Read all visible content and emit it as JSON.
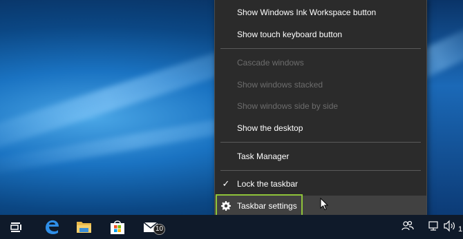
{
  "context_menu": {
    "items": [
      {
        "label": "Show Windows Ink Workspace button",
        "enabled": true
      },
      {
        "label": "Show touch keyboard button",
        "enabled": true
      },
      {
        "label": "Cascade windows",
        "enabled": false
      },
      {
        "label": "Show windows stacked",
        "enabled": false
      },
      {
        "label": "Show windows side by side",
        "enabled": false
      },
      {
        "label": "Show the desktop",
        "enabled": true
      },
      {
        "label": "Task Manager",
        "enabled": true
      },
      {
        "label": "Lock the taskbar",
        "enabled": true,
        "checked": true
      },
      {
        "label": "Taskbar settings",
        "enabled": true,
        "icon": "gear-icon",
        "highlighted": true
      }
    ]
  },
  "taskbar": {
    "icons": [
      "task-view-icon",
      "edge-icon",
      "file-explorer-icon",
      "store-icon",
      "mail-icon"
    ],
    "mail_badge": "10",
    "tray_icons": [
      "people-icon",
      "network-icon",
      "volume-icon"
    ],
    "clock_partial": "1"
  },
  "colors": {
    "menu_bg": "#2b2b2b",
    "menu_text": "#ffffff",
    "menu_disabled_text": "#6d6d6d",
    "highlight_box": "#8fc43a",
    "taskbar_bg": "#0f1a2a"
  }
}
